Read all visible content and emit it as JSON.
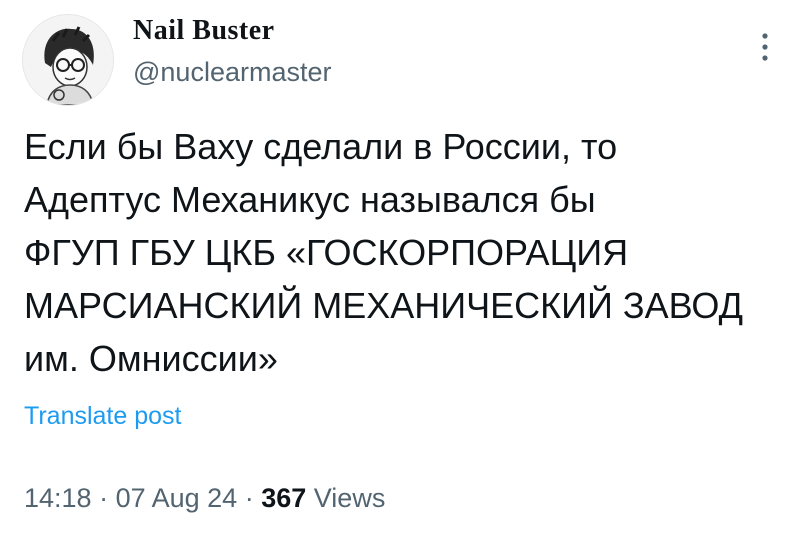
{
  "author": {
    "display_name": "Nail Buster",
    "handle": "@nuclearmaster",
    "avatar_icon": "avatar-portrait-icon"
  },
  "post": {
    "text_lines": [
      "Если бы Ваху сделали в России, то",
      "Адептус Механикус назывался бы",
      "ФГУП ГБУ ЦКБ «ГОСКОРПОРАЦИЯ",
      "МАРСИАНСКИЙ МЕХАНИЧЕСКИЙ ЗАВОД",
      "им. Омниссии»"
    ],
    "translate_label": "Translate post"
  },
  "meta": {
    "time": "14:18",
    "separator": " · ",
    "date": "07 Aug 24",
    "views_count": "367",
    "views_label": "Views"
  },
  "colors": {
    "text": "#0f1419",
    "secondary": "#536471",
    "link": "#1d9bf0"
  }
}
